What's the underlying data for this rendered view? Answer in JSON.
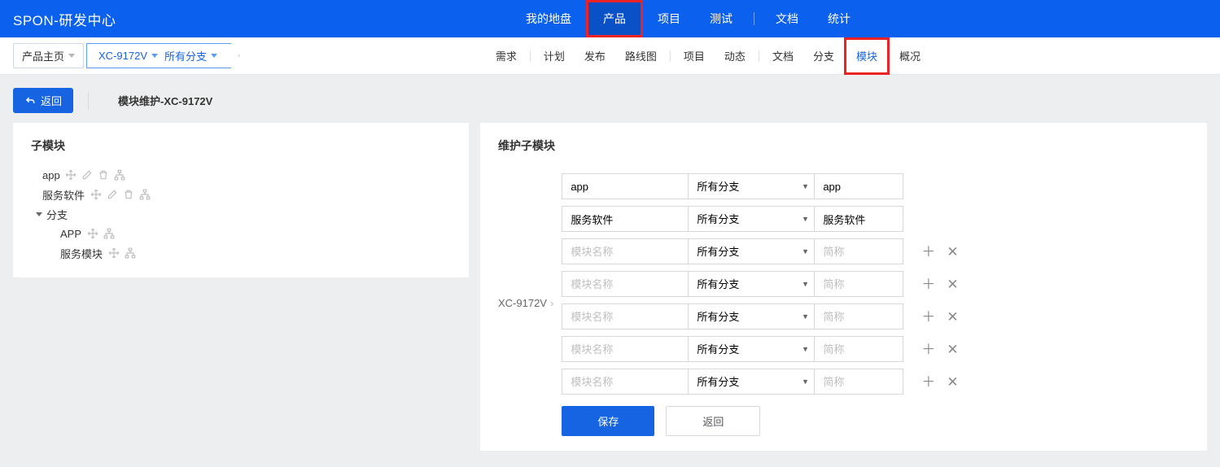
{
  "brand": "SPON-研发中心",
  "topnav": {
    "items": [
      "我的地盘",
      "产品",
      "项目",
      "测试",
      "文档",
      "统计"
    ],
    "active": "产品"
  },
  "subnav": {
    "dropdown": "产品主页",
    "breadcrumb_product": "XC-9172V",
    "breadcrumb_branch": "所有分支",
    "items": [
      "需求",
      "计划",
      "发布",
      "路线图",
      "项目",
      "动态",
      "文档",
      "分支",
      "模块",
      "概况"
    ],
    "active": "模块"
  },
  "toolbar": {
    "back": "返回",
    "title": "模块维护-XC-9172V"
  },
  "left_panel": {
    "title": "子模块",
    "tree": {
      "app": "app",
      "service_soft": "服务软件",
      "branch": "分支",
      "APP": "APP",
      "service_module": "服务模块"
    }
  },
  "right_panel": {
    "title": "维护子模块",
    "parent": "XC-9172V",
    "placeholder_name": "模块名称",
    "placeholder_short": "简称",
    "branch_option": "所有分支",
    "rows": [
      {
        "name": "app",
        "short": "app",
        "icons": false
      },
      {
        "name": "服务软件",
        "short": "服务软件",
        "icons": false
      },
      {
        "name": "",
        "short": "",
        "icons": true
      },
      {
        "name": "",
        "short": "",
        "icons": true
      },
      {
        "name": "",
        "short": "",
        "icons": true
      },
      {
        "name": "",
        "short": "",
        "icons": true
      },
      {
        "name": "",
        "short": "",
        "icons": true
      }
    ],
    "save": "保存",
    "back": "返回"
  }
}
